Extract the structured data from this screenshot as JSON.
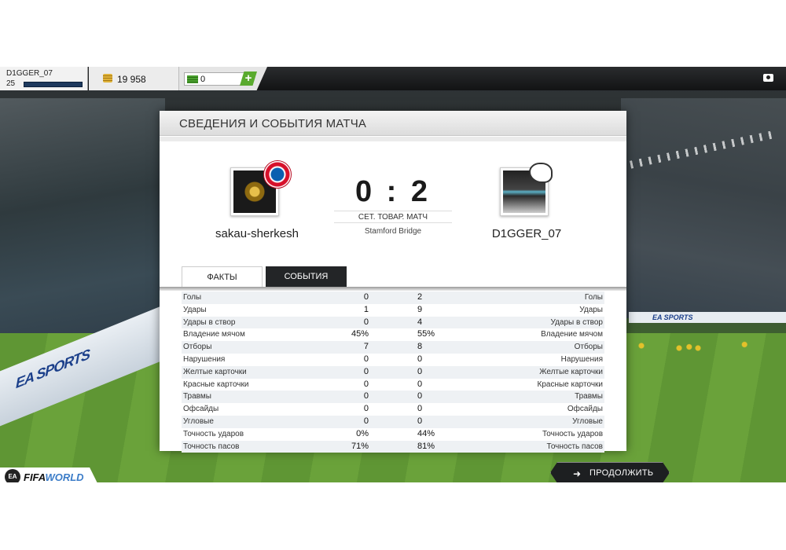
{
  "topbar": {
    "username": "D1GGER_07",
    "level": "25",
    "coins": "19 958",
    "cash": "0",
    "add_cash": "+"
  },
  "panel": {
    "title": "СВЕДЕНИЯ И СОБЫТИЯ МАТЧА",
    "home_team": "sakau-sherkesh",
    "away_team": "D1GGER_07",
    "score": "0 : 2",
    "match_type": "СЕТ. ТОВАР. МАТЧ",
    "stadium": "Stamford Bridge",
    "tabs": [
      "ФАКТЫ",
      "СОБЫТИЯ"
    ],
    "active_tab": "ФАКТЫ"
  },
  "stats": [
    {
      "label": "Голы",
      "home": "0",
      "away": "2"
    },
    {
      "label": "Удары",
      "home": "1",
      "away": "9"
    },
    {
      "label": "Удары в створ",
      "home": "0",
      "away": "4"
    },
    {
      "label": "Владение мячом",
      "home": "45%",
      "away": "55%"
    },
    {
      "label": "Отборы",
      "home": "7",
      "away": "8"
    },
    {
      "label": "Нарушения",
      "home": "0",
      "away": "0"
    },
    {
      "label": "Желтые карточки",
      "home": "0",
      "away": "0"
    },
    {
      "label": "Красные карточки",
      "home": "0",
      "away": "0"
    },
    {
      "label": "Травмы",
      "home": "0",
      "away": "0"
    },
    {
      "label": "Офсайды",
      "home": "0",
      "away": "0"
    },
    {
      "label": "Угловые",
      "home": "0",
      "away": "0"
    },
    {
      "label": "Точность ударов",
      "home": "0%",
      "away": "44%"
    },
    {
      "label": "Точность пасов",
      "home": "71%",
      "away": "81%"
    }
  ],
  "bottom": {
    "logo_ea": "EA",
    "logo_fifa": "FIFA",
    "logo_world": "WORLD",
    "continue_label": "ПРОДОЛЖИТЬ"
  },
  "background": {
    "board_left": "EA SPORTS",
    "board_right": "EA SPORTS"
  }
}
